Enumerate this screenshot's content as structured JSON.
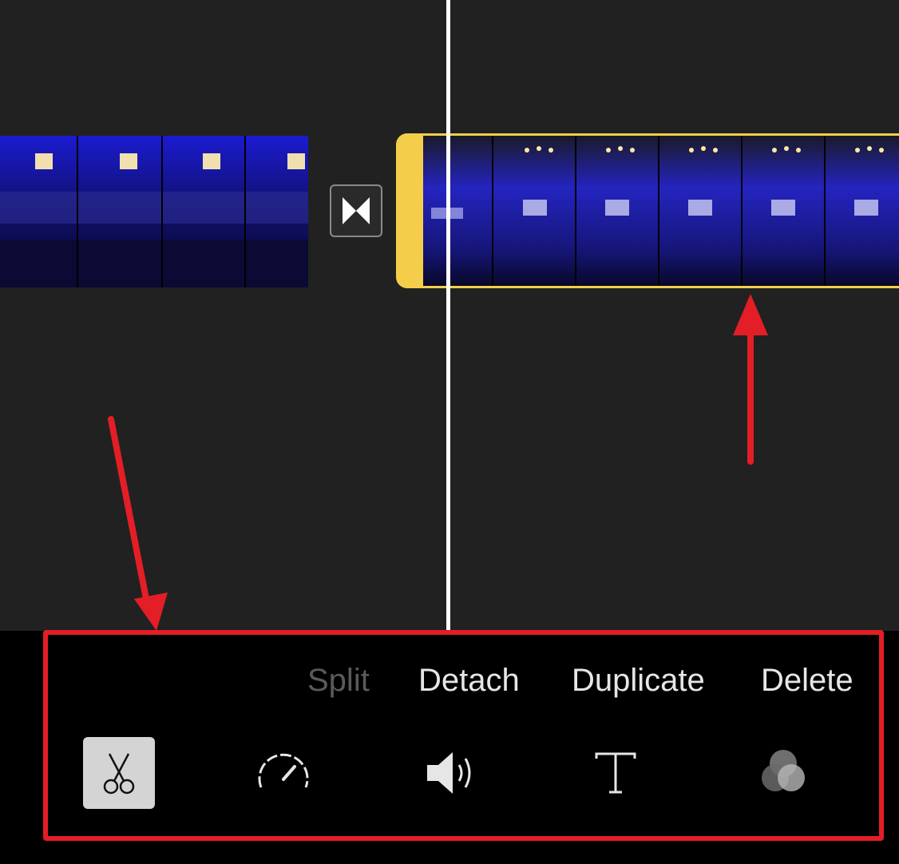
{
  "actions": {
    "split": "Split",
    "detach": "Detach",
    "duplicate": "Duplicate",
    "delete": "Delete"
  },
  "tools": [
    {
      "name": "scissors-icon",
      "selected": true
    },
    {
      "name": "speed-gauge-icon",
      "selected": false
    },
    {
      "name": "volume-icon",
      "selected": false
    },
    {
      "name": "text-icon",
      "selected": false
    },
    {
      "name": "filters-icon",
      "selected": false
    }
  ],
  "colors": {
    "timeline_bg": "#212121",
    "selected_clip_border": "#f4ce4a",
    "annotation_red": "#e41e26",
    "action_text": "#e6e6e6",
    "action_disabled": "#5a5a5a"
  }
}
